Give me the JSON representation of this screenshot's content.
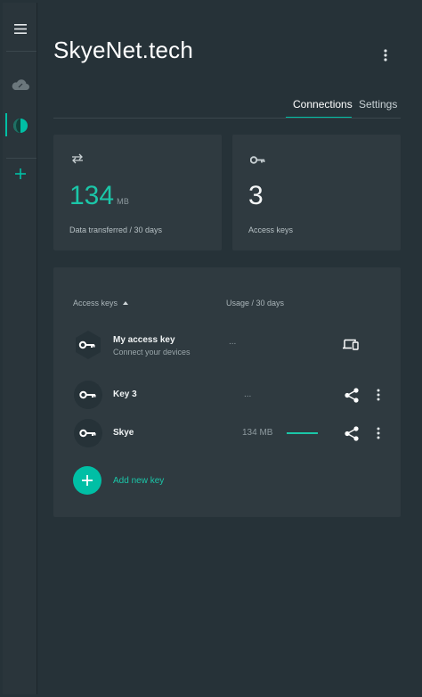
{
  "app": {
    "title": "SkyeNet.tech",
    "accent_color": "#00bfa5"
  },
  "sidebar": {
    "items": [
      {
        "icon": "menu-icon"
      },
      {
        "icon": "cloud-icon"
      },
      {
        "icon": "server-icon",
        "selected": true
      },
      {
        "icon": "add-icon"
      }
    ]
  },
  "tabs": [
    {
      "label": "Connections",
      "active": true
    },
    {
      "label": "Settings",
      "active": false
    }
  ],
  "stats": {
    "transfer": {
      "value": "134",
      "unit": "MB",
      "label": "Data transferred / 30 days"
    },
    "keys": {
      "value": "3",
      "label": "Access keys"
    }
  },
  "table": {
    "header_keys": "Access keys",
    "header_usage": "Usage / 30 days",
    "rows": [
      {
        "name": "My access key",
        "subtitle": "Connect your devices",
        "usage": "...",
        "action_icon": "devices-icon"
      },
      {
        "name": "Key 3",
        "usage": "...",
        "usage_fraction": 0,
        "action_icon": "share-icon"
      },
      {
        "name": "Skye",
        "usage": "134 MB",
        "usage_fraction": 1,
        "action_icon": "share-icon"
      }
    ],
    "add_label": "Add new key"
  }
}
